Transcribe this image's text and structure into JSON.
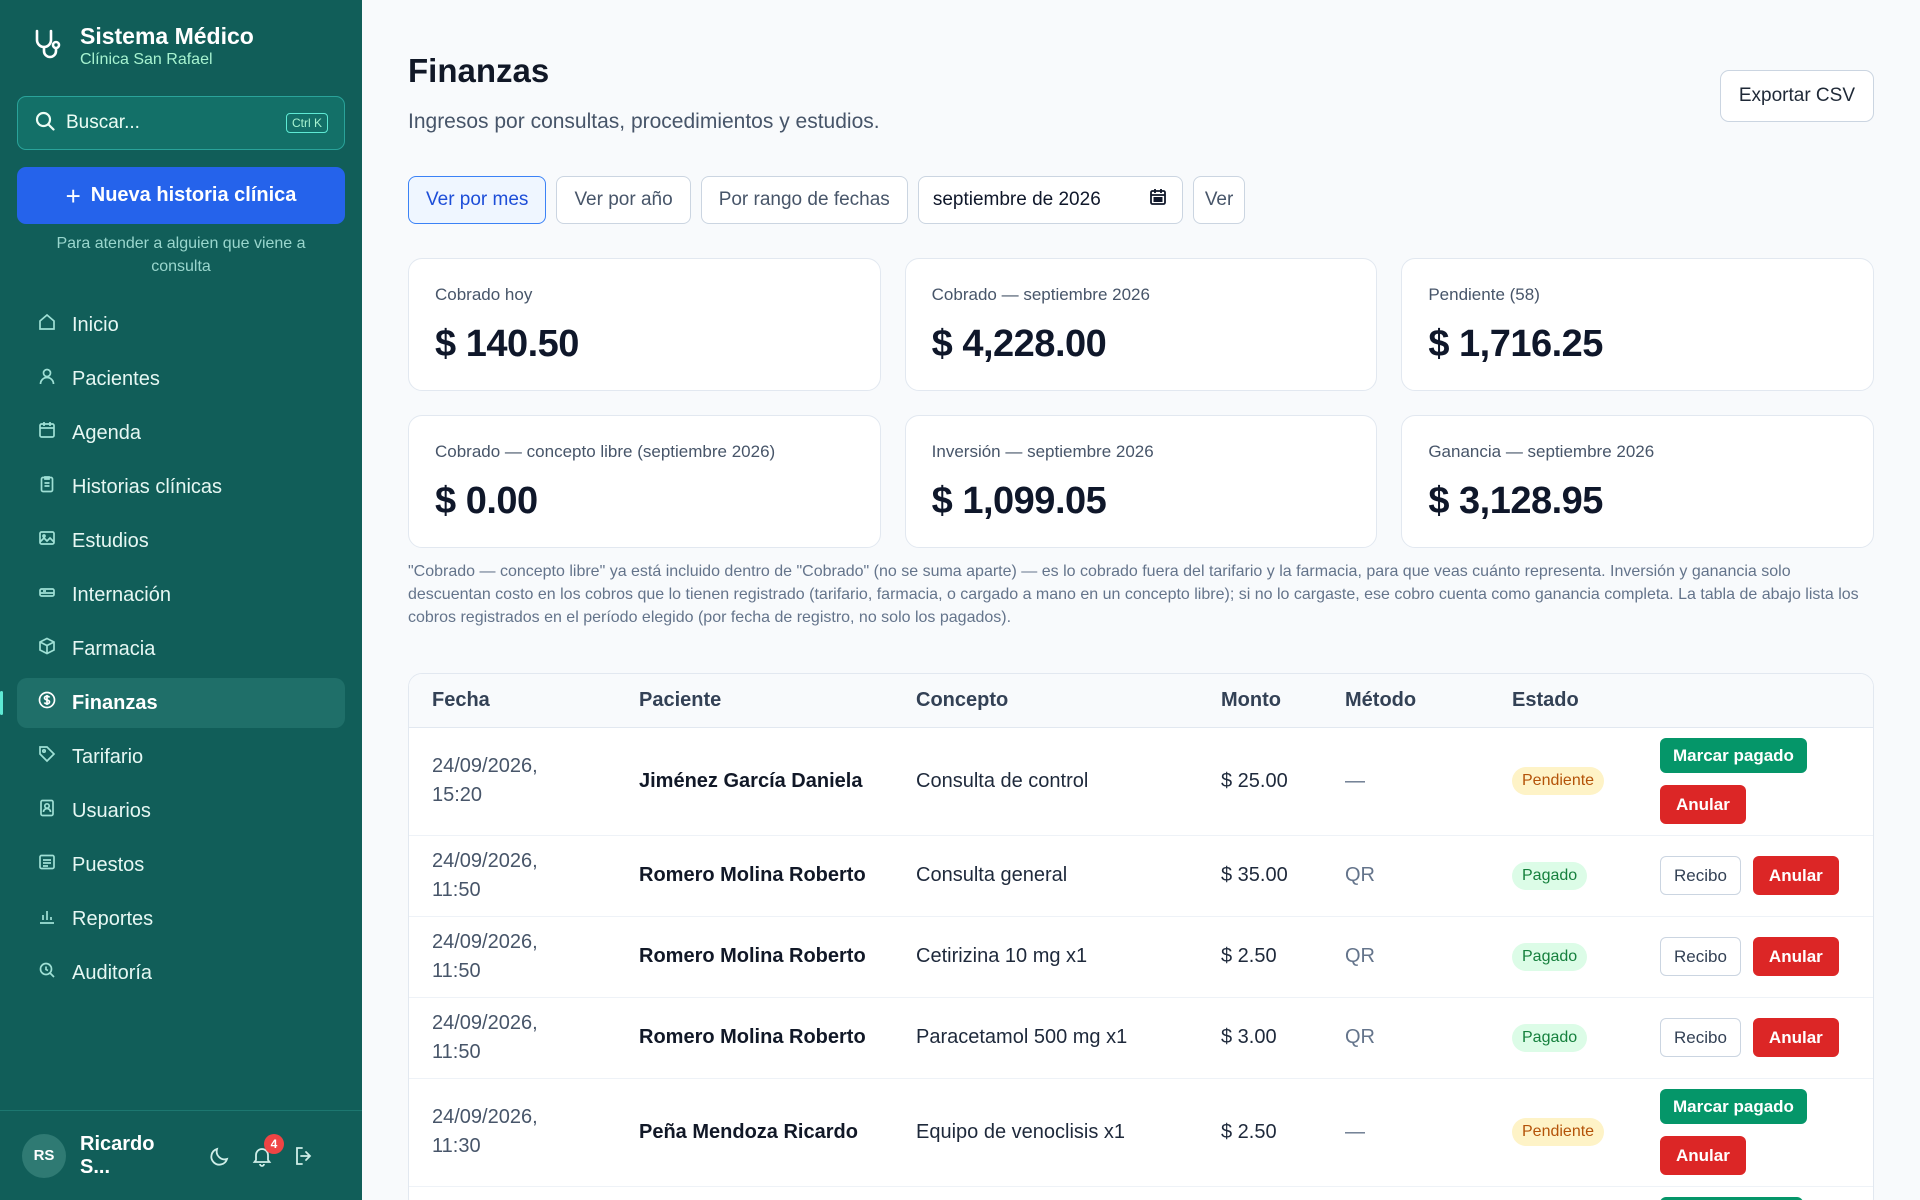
{
  "sidebar": {
    "app_title": "Sistema Médico",
    "clinic": "Clínica San Rafael",
    "search_placeholder": "Buscar...",
    "search_shortcut": "Ctrl K",
    "new_button": "Nueva historia clínica",
    "new_hint": "Para atender a alguien que viene a consulta",
    "items": [
      {
        "label": "Inicio",
        "icon": "home-icon"
      },
      {
        "label": "Pacientes",
        "icon": "user-icon"
      },
      {
        "label": "Agenda",
        "icon": "calendar-icon"
      },
      {
        "label": "Historias clínicas",
        "icon": "clipboard-icon"
      },
      {
        "label": "Estudios",
        "icon": "image-icon"
      },
      {
        "label": "Internación",
        "icon": "bed-icon"
      },
      {
        "label": "Farmacia",
        "icon": "box-icon"
      },
      {
        "label": "Finanzas",
        "icon": "dollar-circle-icon",
        "active": true
      },
      {
        "label": "Tarifario",
        "icon": "tag-icon"
      },
      {
        "label": "Usuarios",
        "icon": "id-badge-icon"
      },
      {
        "label": "Puestos",
        "icon": "list-icon"
      },
      {
        "label": "Reportes",
        "icon": "bar-chart-icon"
      },
      {
        "label": "Auditoría",
        "icon": "search-audit-icon"
      }
    ],
    "user": {
      "initials": "RS",
      "name": "Ricardo S...",
      "notifications": "4"
    }
  },
  "header": {
    "title": "Finanzas",
    "subtitle": "Ingresos por consultas, procedimientos y estudios.",
    "export_label": "Exportar CSV"
  },
  "filters": {
    "by_month": "Ver por mes",
    "by_year": "Ver por año",
    "by_range": "Por rango de fechas",
    "month_value": "septiembre de 2026",
    "view": "Ver"
  },
  "cards": [
    {
      "label": "Cobrado hoy",
      "value": "$ 140.50"
    },
    {
      "label": "Cobrado — septiembre 2026",
      "value": "$ 4,228.00"
    },
    {
      "label": "Pendiente (58)",
      "value": "$ 1,716.25"
    },
    {
      "label": "Cobrado — concepto libre (septiembre 2026)",
      "value": "$ 0.00"
    },
    {
      "label": "Inversión — septiembre 2026",
      "value": "$ 1,099.05"
    },
    {
      "label": "Ganancia — septiembre 2026",
      "value": "$ 3,128.95"
    }
  ],
  "note": "\"Cobrado — concepto libre\" ya está incluido dentro de \"Cobrado\" (no se suma aparte) — es lo cobrado fuera del tarifario y la farmacia, para que veas cuánto representa. Inversión y ganancia solo descuentan costo en los cobros que lo tienen registrado (tarifario, farmacia, o cargado a mano en un concepto libre); si no lo cargaste, ese cobro cuenta como ganancia completa. La tabla de abajo lista los cobros registrados en el período elegido (por fecha de registro, no solo los pagados).",
  "table": {
    "headers": {
      "date": "Fecha",
      "patient": "Paciente",
      "concept": "Concepto",
      "amount": "Monto",
      "method": "Método",
      "state": "Estado"
    },
    "actions": {
      "mark_paid": "Marcar pagado",
      "cancel": "Anular",
      "receipt": "Recibo"
    },
    "rows": [
      {
        "date1": "24/09/2026,",
        "date2": "15:20",
        "patient": "Jiménez García Daniela",
        "concept": "Consulta de control",
        "amount": "$ 25.00",
        "method": "—",
        "state": "Pendiente"
      },
      {
        "date1": "24/09/2026,",
        "date2": "11:50",
        "patient": "Romero Molina Roberto",
        "concept": "Consulta general",
        "amount": "$ 35.00",
        "method": "QR",
        "state": "Pagado"
      },
      {
        "date1": "24/09/2026,",
        "date2": "11:50",
        "patient": "Romero Molina Roberto",
        "concept": "Cetirizina 10 mg x1",
        "amount": "$ 2.50",
        "method": "QR",
        "state": "Pagado"
      },
      {
        "date1": "24/09/2026,",
        "date2": "11:50",
        "patient": "Romero Molina Roberto",
        "concept": "Paracetamol 500 mg x1",
        "amount": "$ 3.00",
        "method": "QR",
        "state": "Pagado"
      },
      {
        "date1": "24/09/2026,",
        "date2": "11:30",
        "patient": "Peña Mendoza Ricardo",
        "concept": "Equipo de venoclisis x1",
        "amount": "$ 2.50",
        "method": "—",
        "state": "Pendiente"
      }
    ]
  }
}
